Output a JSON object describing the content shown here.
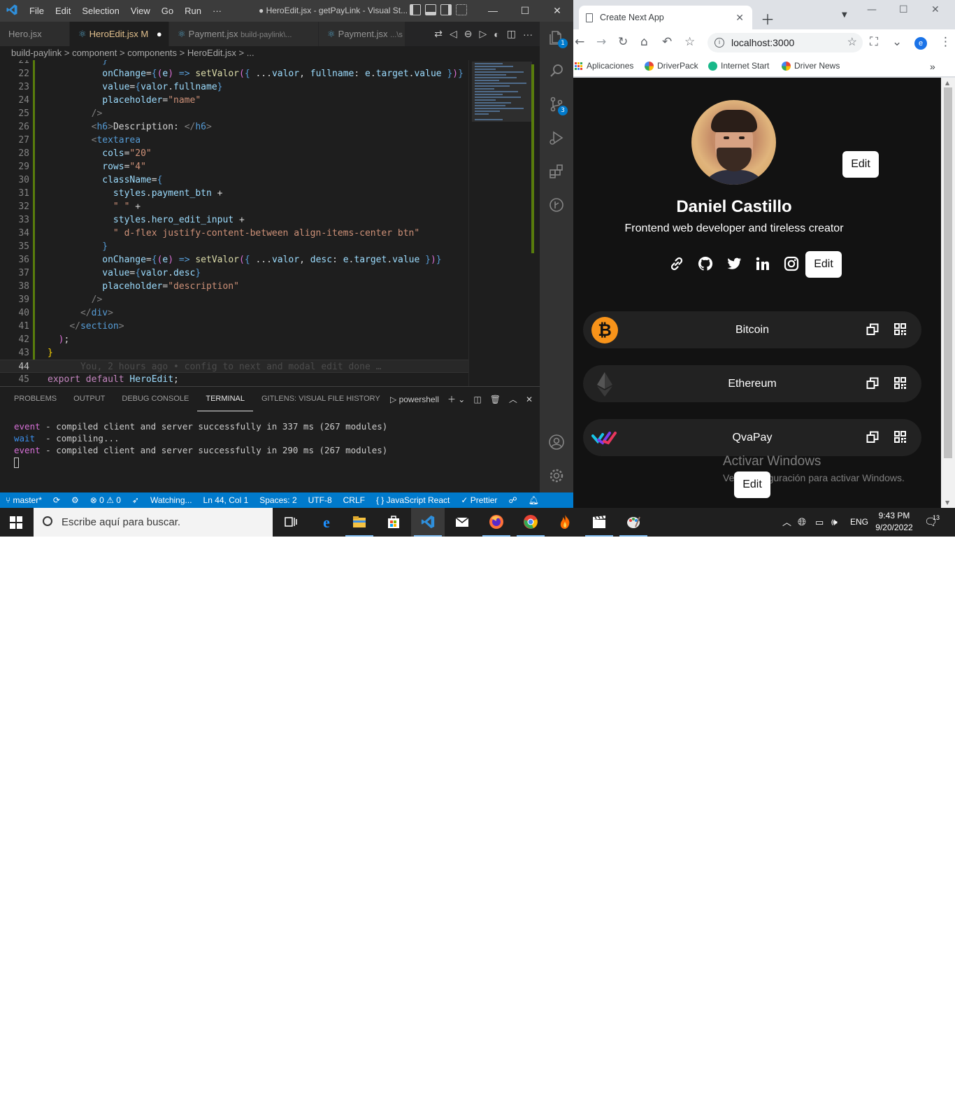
{
  "vscode": {
    "menu": [
      "File",
      "Edit",
      "Selection",
      "View",
      "Go",
      "Run",
      "···"
    ],
    "window_title": "● HeroEdit.jsx - getPayLink - Visual St...",
    "tabs": [
      {
        "label": "Hero.jsx",
        "sub": ""
      },
      {
        "label": "HeroEdit.jsx",
        "sub": "M"
      },
      {
        "label": "Payment.jsx",
        "sub": "build-paylink\\..."
      },
      {
        "label": "Payment.jsx",
        "sub": "...\\s"
      }
    ],
    "breadcrumb": "build-paylink > component > components > HeroEdit.jsx > ...",
    "lines": [
      {
        "n": "21",
        "code": "          }"
      },
      {
        "n": "22",
        "code": "          onChange={(e) => setValor({ ...valor, fullname: e.target.value })}"
      },
      {
        "n": "23",
        "code": "          value={valor.fullname}"
      },
      {
        "n": "24",
        "code": "          placeholder=\"name\""
      },
      {
        "n": "25",
        "code": "        />"
      },
      {
        "n": "26",
        "code": "        <h6>Description: </h6>"
      },
      {
        "n": "27",
        "code": "        <textarea"
      },
      {
        "n": "28",
        "code": "          cols=\"20\""
      },
      {
        "n": "29",
        "code": "          rows=\"4\""
      },
      {
        "n": "30",
        "code": "          className={"
      },
      {
        "n": "31",
        "code": "            styles.payment_btn +"
      },
      {
        "n": "32",
        "code": "            \" \" +"
      },
      {
        "n": "33",
        "code": "            styles.hero_edit_input +"
      },
      {
        "n": "34",
        "code": "            \" d-flex justify-content-between align-items-center btn\""
      },
      {
        "n": "35",
        "code": "          }"
      },
      {
        "n": "36",
        "code": "          onChange={(e) => setValor({ ...valor, desc: e.target.value })}"
      },
      {
        "n": "37",
        "code": "          value={valor.desc}"
      },
      {
        "n": "38",
        "code": "          placeholder=\"description\""
      },
      {
        "n": "39",
        "code": "        />"
      },
      {
        "n": "40",
        "code": "      </div>"
      },
      {
        "n": "41",
        "code": "    </section>"
      },
      {
        "n": "42",
        "code": "  );"
      },
      {
        "n": "43",
        "code": "}"
      },
      {
        "n": "44",
        "code": "      You, 2 hours ago • config to next and modal edit done …"
      },
      {
        "n": "45",
        "code": "export default HeroEdit;"
      }
    ],
    "panel_tabs": [
      "PROBLEMS",
      "OUTPUT",
      "DEBUG CONSOLE",
      "TERMINAL",
      "GITLENS: VISUAL FILE HISTORY"
    ],
    "shell": "powershell",
    "terminal": [
      {
        "tag": "event",
        "text": " - compiled client and server successfully in 337 ms (267 modules)"
      },
      {
        "tag": "wait",
        "text": "  - compiling..."
      },
      {
        "tag": "event",
        "text": " - compiled client and server successfully in 290 ms (267 modules)"
      }
    ],
    "activity_badges": {
      "explorer": "1",
      "scm": "3"
    },
    "status": {
      "branch": "master*",
      "problems": "⊗ 0 ⚠ 0",
      "watching": "Watching...",
      "position": "Ln 44, Col 1",
      "spaces": "Spaces: 2",
      "encoding": "UTF-8",
      "eol": "CRLF",
      "language": "{ } JavaScript React",
      "prettier": "✓ Prettier"
    }
  },
  "browser": {
    "tab_title": "Create Next App",
    "url": "localhost:3000",
    "profile_initial": "e",
    "bookmarks": [
      "Aplicaciones",
      "DriverPack",
      "Internet Start",
      "Driver News"
    ],
    "page": {
      "name": "Daniel Castillo",
      "tagline": "Frontend web developer and tireless creator",
      "edit_label": "Edit",
      "payments": [
        "Bitcoin",
        "Ethereum",
        "QvaPay"
      ],
      "watermark_title": "Activar Windows",
      "watermark_sub": "Ve a Configuración para activar Windows."
    }
  },
  "taskbar": {
    "search_placeholder": "Escribe aquí para buscar.",
    "lang": "ENG",
    "time": "9:43 PM",
    "date": "9/20/2022",
    "notifications": "13"
  },
  "colors": {
    "vscode_blue": "#007acc",
    "bitcoin_orange": "#f7931a",
    "editor_bg": "#1e1e1e",
    "page_bg": "#121212"
  }
}
